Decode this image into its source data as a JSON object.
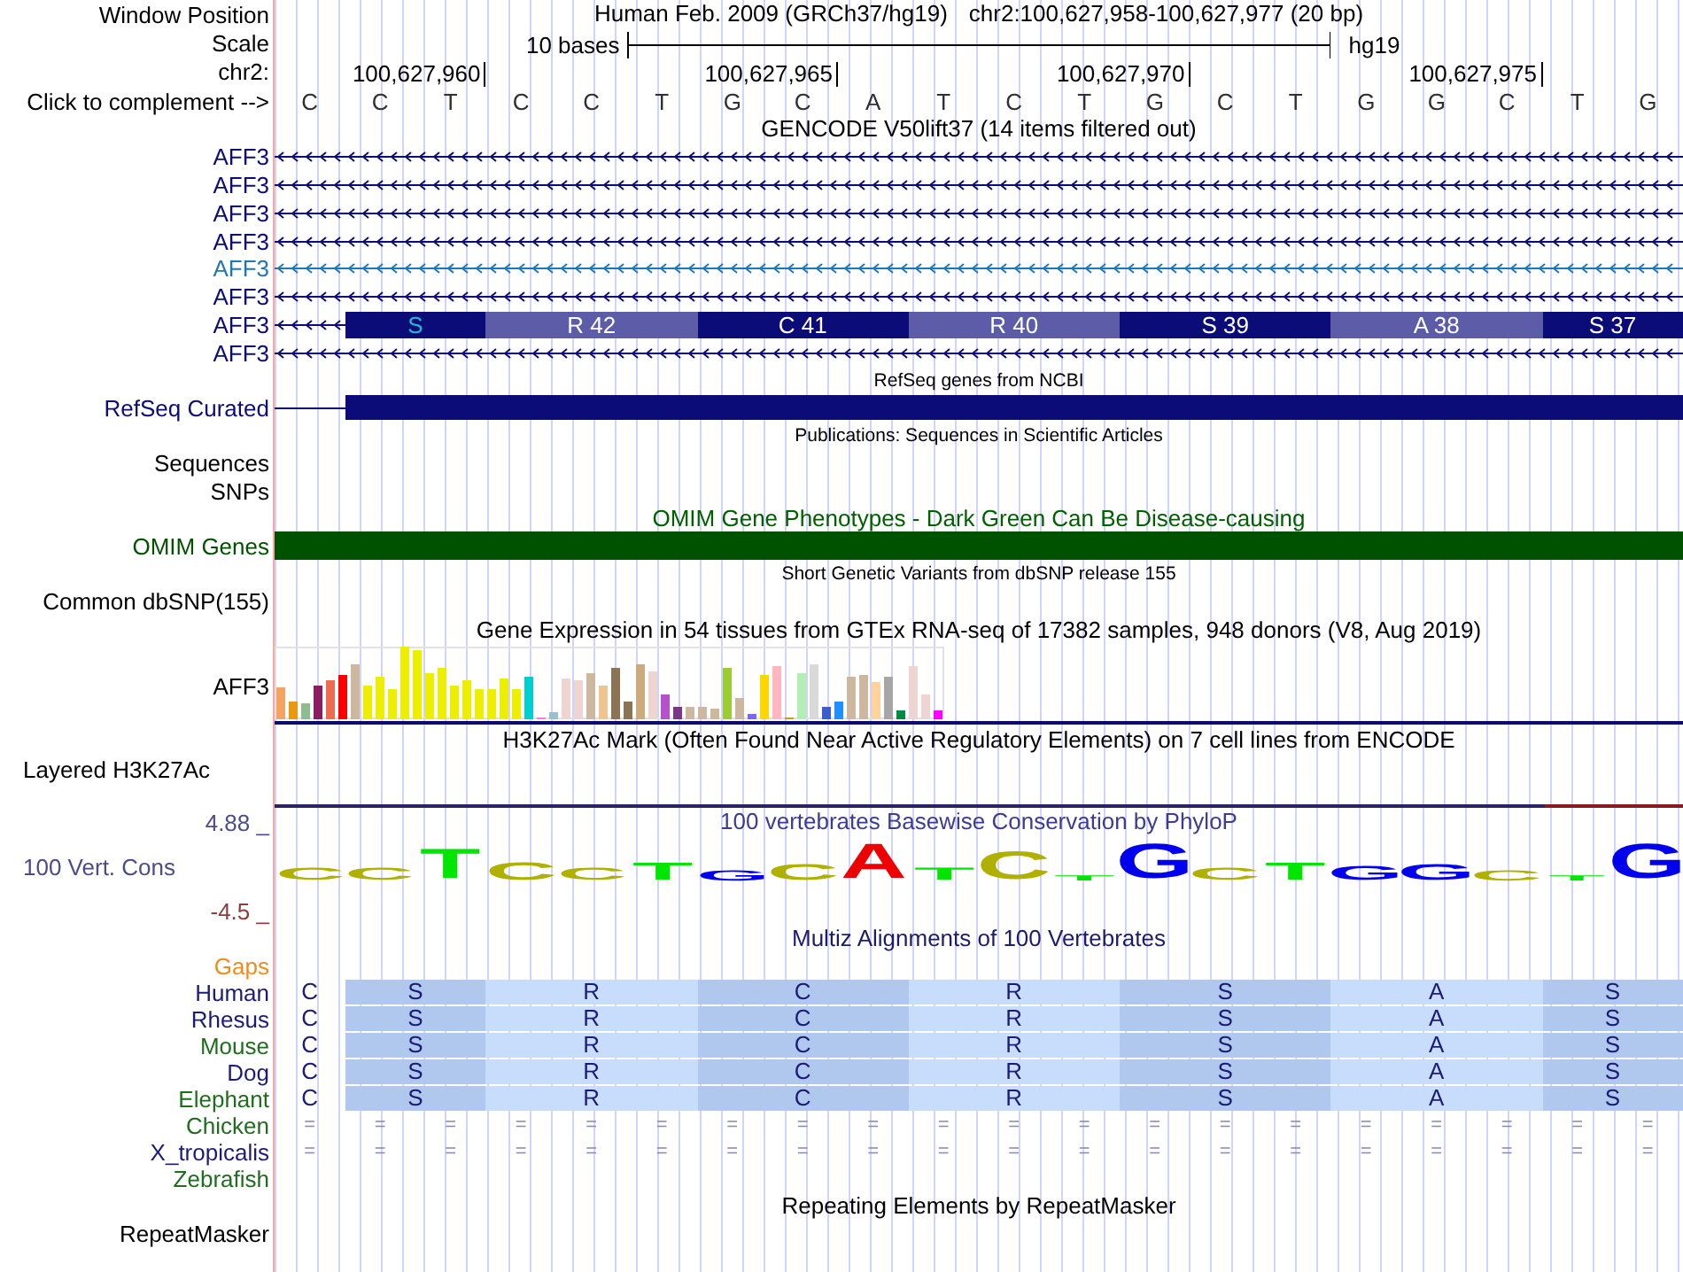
{
  "window_position": {
    "label": "Window Position",
    "assembly": "Human Feb. 2009 (GRCh37/hg19)",
    "range": "chr2:100,627,958-100,627,977 (20 bp)"
  },
  "scale": {
    "label": "Scale",
    "length": "10 bases",
    "assembly": "hg19"
  },
  "ruler": {
    "label": "chr2:",
    "ticks": [
      "100,627,960",
      "100,627,965",
      "100,627,970",
      "100,627,975"
    ]
  },
  "sequence": {
    "label": "Click to complement -->",
    "bases": [
      "C",
      "C",
      "T",
      "C",
      "C",
      "T",
      "G",
      "C",
      "A",
      "T",
      "C",
      "T",
      "G",
      "C",
      "T",
      "G",
      "G",
      "C",
      "T",
      "G"
    ]
  },
  "tracks": [
    {
      "kind": "transcripts",
      "title": {
        "text": "GENCODE V50lift37 (14 items filtered out)",
        "small": false,
        "color": "#000000"
      },
      "transcripts": [
        {
          "name": "AFF3",
          "color": "#0c0c78"
        },
        {
          "name": "AFF3",
          "color": "#0c0c78"
        },
        {
          "name": "AFF3",
          "color": "#0c0c78"
        },
        {
          "name": "AFF3",
          "color": "#0c0c78"
        },
        {
          "name": "AFF3",
          "color": "#1f78b4"
        },
        {
          "name": "AFF3",
          "color": "#0c0c78"
        },
        {
          "name": "AFF3",
          "color": "#0c0c78",
          "codons": [
            {
              "label": "S",
              "partial": true
            },
            {
              "label": "R 42",
              "partial": false
            },
            {
              "label": "C 41",
              "partial": false
            },
            {
              "label": "R 40",
              "partial": false
            },
            {
              "label": "S 39",
              "partial": false
            },
            {
              "label": "A 38",
              "partial": false
            },
            {
              "label": "S 37",
              "partial": false
            }
          ]
        },
        {
          "name": "AFF3",
          "color": "#0c0c78"
        }
      ]
    },
    {
      "kind": "gene_bar",
      "title": {
        "text": "RefSeq genes from NCBI",
        "small": true,
        "color": "#000000"
      },
      "label": "RefSeq Curated",
      "color": "#0c0c78",
      "lead_line": true
    },
    {
      "kind": "labels",
      "title": {
        "text": "Publications: Sequences in Scientific Articles",
        "small": true,
        "color": "#000000"
      },
      "labels": [
        "Sequences",
        "SNPs"
      ]
    },
    {
      "kind": "gene_bar",
      "title": {
        "text": "OMIM Gene Phenotypes - Dark Green Can Be Disease-causing",
        "small": false,
        "color": "#006000"
      },
      "label": "OMIM Genes",
      "color": "#005200",
      "lead_line": false
    },
    {
      "kind": "labels",
      "title": {
        "text": "Short Genetic Variants from dbSNP release 155",
        "small": true,
        "color": "#000000"
      },
      "labels": [
        "Common dbSNP(155)"
      ]
    },
    {
      "kind": "expression",
      "title": {
        "text": "Gene Expression in 54 tissues from GTEx RNA-seq of 17382 samples, 948 donors (V8, Aug 2019)",
        "small": false,
        "color": "#000000"
      },
      "label": "AFF3"
    },
    {
      "kind": "signal",
      "title": {
        "text": "H3K27Ac Mark (Often Found Near Active Regulatory Elements) on 7 cell lines from ENCODE",
        "small": false,
        "color": "#000000"
      },
      "label": "Layered H3K27Ac"
    },
    {
      "kind": "conservation",
      "title": {
        "text": "100 vertebrates Basewise Conservation by PhyloP",
        "small": false,
        "color": "#3c3c96"
      },
      "label": "100 Vert. Cons",
      "max": "4.88 _",
      "min": "-4.5 _",
      "logo": [
        {
          "base": "C",
          "color": "#b0b000"
        },
        {
          "base": "C",
          "color": "#b0b000"
        },
        {
          "base": "T",
          "color": "#00e600"
        },
        {
          "base": "C",
          "color": "#b0b000"
        },
        {
          "base": "C",
          "color": "#b0b000"
        },
        {
          "base": "T",
          "color": "#00e600"
        },
        {
          "base": "G",
          "color": "#0000ee"
        },
        {
          "base": "C",
          "color": "#b0b000"
        },
        {
          "base": "A",
          "color": "#ee0000"
        },
        {
          "base": "T",
          "color": "#00e600"
        },
        {
          "base": "C",
          "color": "#b0b000"
        },
        {
          "base": "T",
          "color": "#00e600"
        },
        {
          "base": "G",
          "color": "#0000ee"
        },
        {
          "base": "C",
          "color": "#b0b000"
        },
        {
          "base": "T",
          "color": "#00e600"
        },
        {
          "base": "G",
          "color": "#0000ee"
        },
        {
          "base": "G",
          "color": "#0000ee"
        },
        {
          "base": "C",
          "color": "#b0b000"
        },
        {
          "base": "T",
          "color": "#00e600"
        },
        {
          "base": "G",
          "color": "#0000ee"
        }
      ]
    },
    {
      "kind": "alignment",
      "title": {
        "text": "Multiz Alignments of 100 Vertebrates",
        "small": false,
        "color": "#1c1c6c"
      },
      "gaps": {
        "text": "Gaps",
        "color": "#f08c1c"
      },
      "species": [
        {
          "name": "Human",
          "color": "#1c1c78",
          "kind": "codons",
          "first_base": "C",
          "codons": [
            "S",
            "R",
            "C",
            "R",
            "S",
            "A",
            "S"
          ]
        },
        {
          "name": "Rhesus",
          "color": "#1c1c78",
          "kind": "codons",
          "first_base": "C",
          "codons": [
            "S",
            "R",
            "C",
            "R",
            "S",
            "A",
            "S"
          ]
        },
        {
          "name": "Mouse",
          "color": "#1e6e1e",
          "kind": "codons",
          "first_base": "C",
          "codons": [
            "S",
            "R",
            "C",
            "R",
            "S",
            "A",
            "S"
          ]
        },
        {
          "name": "Dog",
          "color": "#1c1c78",
          "kind": "codons",
          "first_base": "C",
          "codons": [
            "S",
            "R",
            "C",
            "R",
            "S",
            "A",
            "S"
          ]
        },
        {
          "name": "Elephant",
          "color": "#1e6e1e",
          "kind": "codons",
          "first_base": "C",
          "codons": [
            "S",
            "R",
            "C",
            "R",
            "S",
            "A",
            "S"
          ]
        },
        {
          "name": "Chicken",
          "color": "#1e6e1e",
          "kind": "marks",
          "marks": [
            "=",
            "=",
            "=",
            "=",
            "=",
            "=",
            "=",
            "=",
            "=",
            "=",
            "=",
            "=",
            "=",
            "=",
            "=",
            "=",
            "=",
            "=",
            "=",
            "="
          ]
        },
        {
          "name": "X_tropicalis",
          "color": "#1c1c78",
          "kind": "marks",
          "marks": [
            "=",
            "=",
            "=",
            "=",
            "=",
            "=",
            "=",
            "=",
            "=",
            "=",
            "=",
            "=",
            "=",
            "=",
            "=",
            "=",
            "=",
            "=",
            "=",
            "="
          ]
        },
        {
          "name": "Zebrafish",
          "color": "#1e6e1e",
          "kind": "blank"
        }
      ]
    },
    {
      "kind": "labels",
      "title": {
        "text": "Repeating Elements by RepeatMasker",
        "small": false,
        "color": "#000000"
      },
      "labels": [
        "RepeatMasker"
      ]
    }
  ]
}
